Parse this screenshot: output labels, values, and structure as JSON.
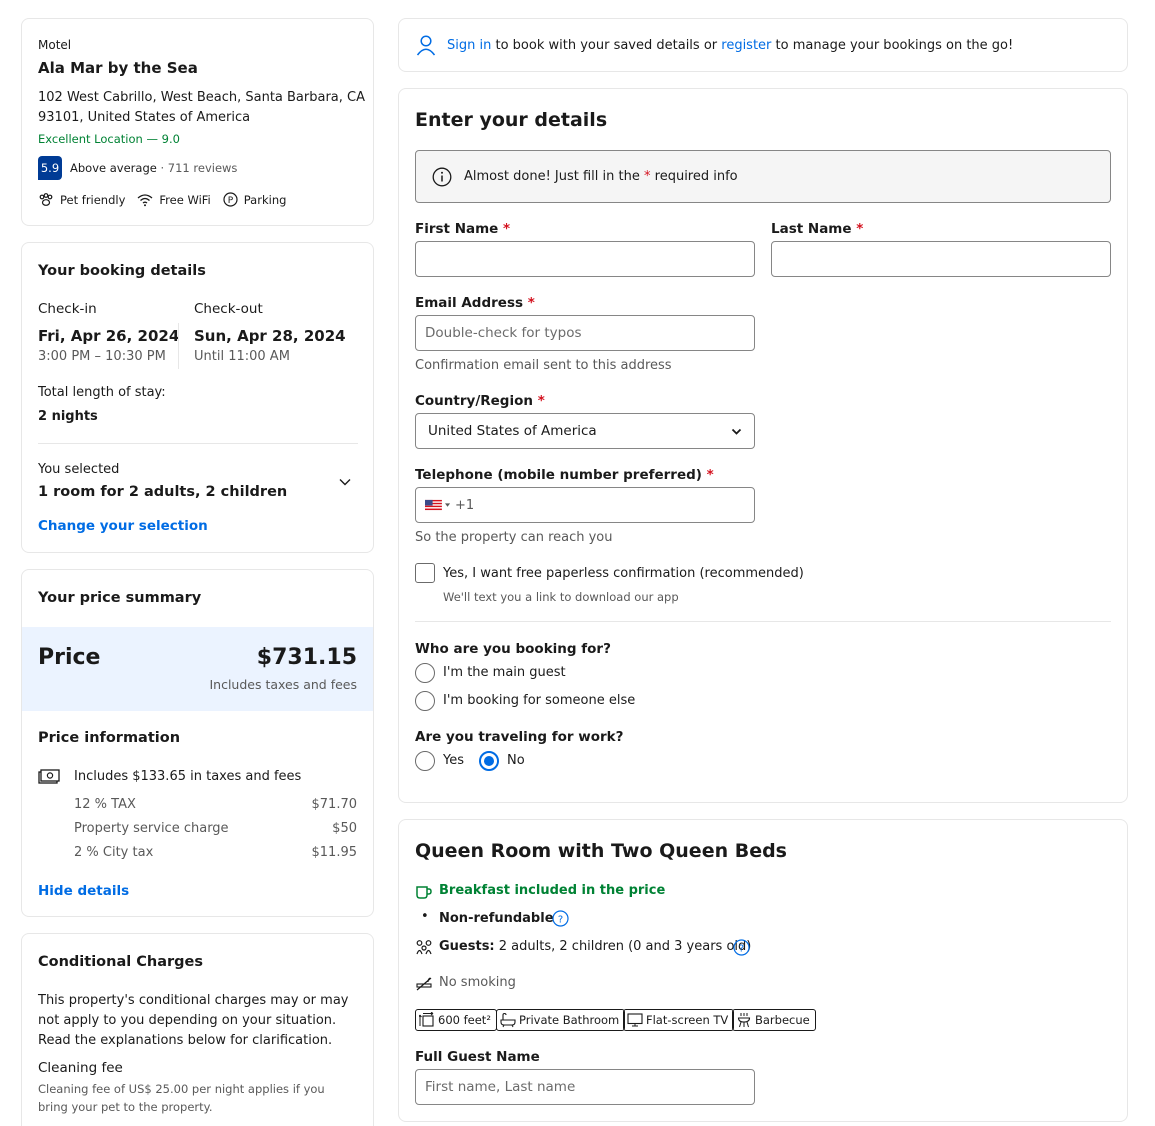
{
  "hotel": {
    "type": "Motel",
    "name": "Ala Mar by the Sea",
    "address_line1": "102 West Cabrillo, West Beach, Santa Barbara, CA",
    "address_line2": "93101, United States of America",
    "location_rating": "Excellent Location — 9.0",
    "score": "5.9",
    "score_label": "Above average",
    "reviews": "· 711 reviews",
    "amenities": [
      "Pet friendly",
      "Free WiFi",
      "Parking"
    ]
  },
  "booking": {
    "title": "Your booking details",
    "checkin_label": "Check-in",
    "checkin_date": "Fri, Apr 26, 2024",
    "checkin_time": "3:00 PM – 10:30 PM",
    "checkout_label": "Check-out",
    "checkout_date": "Sun, Apr 28, 2024",
    "checkout_time": "Until 11:00 AM",
    "stay_label": "Total length of stay:",
    "stay_value": "2 nights",
    "selected_label": "You selected",
    "selected_value": "1 room for 2 adults, 2 children",
    "change_link": "Change your selection"
  },
  "price": {
    "title": "Your price summary",
    "price_label": "Price",
    "price_value": "$731.15",
    "price_note": "Includes taxes and fees",
    "info_title": "Price information",
    "includes": "Includes $133.65 in taxes and fees",
    "lines": [
      {
        "label": "12 % TAX",
        "value": "$71.70"
      },
      {
        "label": "Property service charge",
        "value": "$50"
      },
      {
        "label": "2 % City tax",
        "value": "$11.95"
      }
    ],
    "hide_link": "Hide details"
  },
  "conditional": {
    "title": "Conditional Charges",
    "text": "This property's conditional charges may or may not apply to you depending on your situation. Read the explanations below for clarification.",
    "fee_title": "Cleaning fee",
    "fee_text": "Cleaning fee of US$ 25.00 per night applies if you bring your pet to the property."
  },
  "signin": {
    "sign_in": "Sign in",
    "text1": "to book with your saved details or",
    "register": "register",
    "text2": "to manage your bookings on the go!"
  },
  "form": {
    "title": "Enter your details",
    "notice_pre": "Almost done! Just fill in the",
    "notice_star": "*",
    "notice_post": "required info",
    "first_name_label": "First Name",
    "last_name_label": "Last Name",
    "email_label": "Email Address",
    "email_placeholder": "Double-check for typos",
    "email_help": "Confirmation email sent to this address",
    "country_label": "Country/Region",
    "country_value": "United States of America",
    "phone_label": "Telephone (mobile number preferred)",
    "phone_prefix": "+1",
    "phone_help": "So the property can reach you",
    "paperless_label": "Yes, I want free paperless confirmation (recommended)",
    "paperless_help": "We'll text you a link to download our app",
    "booking_for_title": "Who are you booking for?",
    "booking_for_options": [
      "I'm the main guest",
      "I'm booking for someone else"
    ],
    "work_title": "Are you traveling for work?",
    "work_options": [
      "Yes",
      "No"
    ],
    "work_selected": "No"
  },
  "room": {
    "title": "Queen Room with Two Queen Beds",
    "breakfast": "Breakfast included in the price",
    "refund": "Non-refundable",
    "guests_label": "Guests:",
    "guests_value": "2 adults, 2 children (0 and 3 years old)",
    "smoking": "No smoking",
    "facilities": [
      "600 feet²",
      "Private Bathroom",
      "Flat-screen TV",
      "Barbecue"
    ],
    "guest_name_label": "Full Guest Name",
    "guest_name_placeholder": "First name, Last name"
  },
  "colors": {
    "brand_blue": "#006ce4",
    "score_blue": "#003b95",
    "green": "#008234",
    "required_red": "#d4111e",
    "price_bg": "#ebf3ff"
  }
}
